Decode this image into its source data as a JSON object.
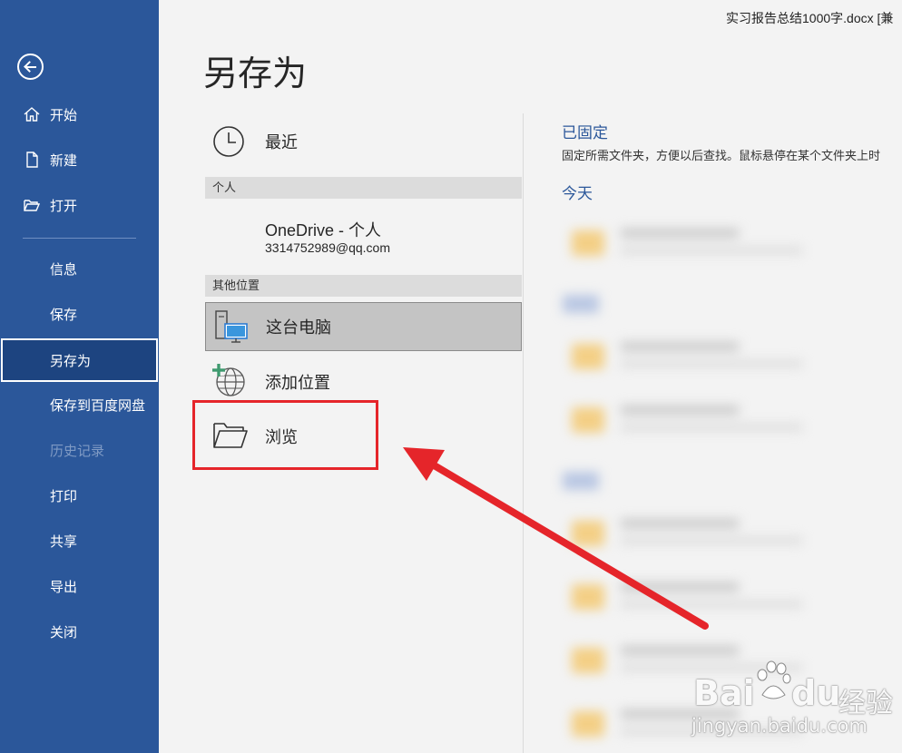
{
  "window": {
    "doc_title": "实习报告总结1000字.docx [兼"
  },
  "sidebar": {
    "items": [
      {
        "label": "开始",
        "icon": "home-icon"
      },
      {
        "label": "新建",
        "icon": "new-document-icon"
      },
      {
        "label": "打开",
        "icon": "open-folder-icon"
      },
      {
        "label": "信息"
      },
      {
        "label": "保存"
      },
      {
        "label": "另存为",
        "selected": true
      },
      {
        "label": "保存到百度网盘"
      },
      {
        "label": "历史记录",
        "disabled": true
      },
      {
        "label": "打印"
      },
      {
        "label": "共享"
      },
      {
        "label": "导出"
      },
      {
        "label": "关闭"
      }
    ]
  },
  "main": {
    "title": "另存为",
    "recent_label": "最近",
    "personal_header": "个人",
    "onedrive_name": "OneDrive - 个人",
    "onedrive_email": "3314752989@qq.com",
    "other_header": "其他位置",
    "this_pc_label": "这台电脑",
    "add_place_label": "添加位置",
    "browse_label": "浏览"
  },
  "right_pane": {
    "pinned_title": "已固定",
    "pinned_desc": "固定所需文件夹，方便以后查找。鼠标悬停在某个文件夹上时",
    "today_label": "今天"
  },
  "watermark": {
    "brand": "Bai",
    "brand_tail": "du",
    "suffix": "经验",
    "url": "jingyan.baidu.com"
  },
  "colors": {
    "sidebar_bg": "#2b579a",
    "selected_bg": "#1d4480",
    "accent": "#2b579a",
    "annotation_red": "#e5252a"
  }
}
